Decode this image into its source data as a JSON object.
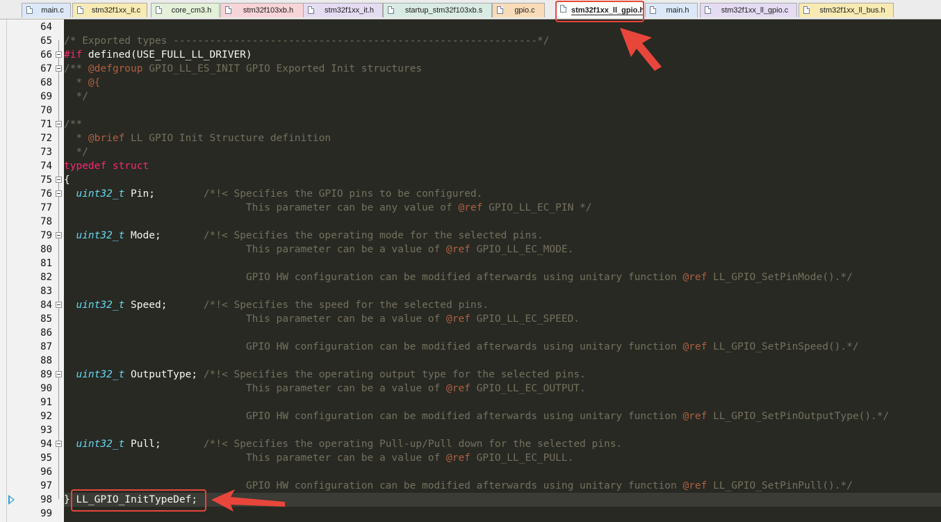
{
  "tabs": [
    {
      "label": "main.c",
      "color": "#dce8f7"
    },
    {
      "label": "stm32f1xx_it.c",
      "color": "#f7eab3"
    },
    {
      "label": "core_cm3.h",
      "color": "#e3f1d8"
    },
    {
      "label": "stm32f103xb.h",
      "color": "#f7d4d7"
    },
    {
      "label": "stm32f1xx_it.h",
      "color": "#e5dcf3"
    },
    {
      "label": "startup_stm32f103xb.s",
      "color": "#d9ece4"
    },
    {
      "label": "gpio.c",
      "color": "#f8dcb8"
    },
    {
      "label": "stm32f1xx_ll_gpio.h",
      "color": "#ffffff",
      "active": true
    },
    {
      "label": "main.h",
      "color": "#dce8f7"
    },
    {
      "label": "stm32f1xx_ll_gpio.c",
      "color": "#e5dcf3"
    },
    {
      "label": "stm32f1xx_ll_bus.h",
      "color": "#f7eab3"
    }
  ],
  "editor": {
    "current_line": "98",
    "lines": [
      {
        "n": "64",
        "segs": []
      },
      {
        "n": "65",
        "segs": [
          [
            "c-com",
            "/* Exported types ------------------------------------------------------------*/"
          ]
        ]
      },
      {
        "n": "66",
        "fold": true,
        "segs": [
          [
            "c-kw",
            "#if"
          ],
          [
            "c-id",
            " defined(USE_FULL_LL_DRIVER)"
          ]
        ]
      },
      {
        "n": "67",
        "fold": true,
        "segs": [
          [
            "c-com",
            "/** "
          ],
          [
            "c-tag",
            "@defgroup"
          ],
          [
            "c-com",
            " GPIO_LL_ES_INIT GPIO Exported Init structures"
          ]
        ]
      },
      {
        "n": "68",
        "segs": [
          [
            "c-com",
            "  * "
          ],
          [
            "c-tag",
            "@{"
          ]
        ]
      },
      {
        "n": "69",
        "segs": [
          [
            "c-com",
            "  */"
          ]
        ]
      },
      {
        "n": "70",
        "segs": []
      },
      {
        "n": "71",
        "fold": true,
        "segs": [
          [
            "c-com",
            "/**"
          ]
        ]
      },
      {
        "n": "72",
        "segs": [
          [
            "c-com",
            "  * "
          ],
          [
            "c-tag",
            "@brief"
          ],
          [
            "c-com",
            " LL GPIO Init Structure definition"
          ]
        ]
      },
      {
        "n": "73",
        "segs": [
          [
            "c-com",
            "  */"
          ]
        ]
      },
      {
        "n": "74",
        "segs": [
          [
            "c-kw",
            "typedef struct"
          ]
        ]
      },
      {
        "n": "75",
        "fold": true,
        "segs": [
          [
            "c-id",
            "{"
          ]
        ]
      },
      {
        "n": "76",
        "fold": true,
        "segs": [
          [
            "c-ty",
            "  uint32_t"
          ],
          [
            "c-id",
            " Pin;        "
          ],
          [
            "c-com",
            "/*!< Specifies the GPIO pins to be configured."
          ]
        ]
      },
      {
        "n": "77",
        "segs": [
          [
            "c-com",
            "                              This parameter can be any value of "
          ],
          [
            "c-tag",
            "@ref"
          ],
          [
            "c-com",
            " GPIO_LL_EC_PIN */"
          ]
        ]
      },
      {
        "n": "78",
        "segs": []
      },
      {
        "n": "79",
        "fold": true,
        "segs": [
          [
            "c-ty",
            "  uint32_t"
          ],
          [
            "c-id",
            " Mode;       "
          ],
          [
            "c-com",
            "/*!< Specifies the operating mode for the selected pins."
          ]
        ]
      },
      {
        "n": "80",
        "segs": [
          [
            "c-com",
            "                              This parameter can be a value of "
          ],
          [
            "c-tag",
            "@ref"
          ],
          [
            "c-com",
            " GPIO_LL_EC_MODE."
          ]
        ]
      },
      {
        "n": "81",
        "segs": []
      },
      {
        "n": "82",
        "segs": [
          [
            "c-com",
            "                              GPIO HW configuration can be modified afterwards using unitary function "
          ],
          [
            "c-tag",
            "@ref"
          ],
          [
            "c-com",
            " LL_GPIO_SetPinMode().*/"
          ]
        ]
      },
      {
        "n": "83",
        "segs": []
      },
      {
        "n": "84",
        "fold": true,
        "segs": [
          [
            "c-ty",
            "  uint32_t"
          ],
          [
            "c-id",
            " Speed;      "
          ],
          [
            "c-com",
            "/*!< Specifies the speed for the selected pins."
          ]
        ]
      },
      {
        "n": "85",
        "segs": [
          [
            "c-com",
            "                              This parameter can be a value of "
          ],
          [
            "c-tag",
            "@ref"
          ],
          [
            "c-com",
            " GPIO_LL_EC_SPEED."
          ]
        ]
      },
      {
        "n": "86",
        "segs": []
      },
      {
        "n": "87",
        "segs": [
          [
            "c-com",
            "                              GPIO HW configuration can be modified afterwards using unitary function "
          ],
          [
            "c-tag",
            "@ref"
          ],
          [
            "c-com",
            " LL_GPIO_SetPinSpeed().*/"
          ]
        ]
      },
      {
        "n": "88",
        "segs": []
      },
      {
        "n": "89",
        "fold": true,
        "segs": [
          [
            "c-ty",
            "  uint32_t"
          ],
          [
            "c-id",
            " OutputType; "
          ],
          [
            "c-com",
            "/*!< Specifies the operating output type for the selected pins."
          ]
        ]
      },
      {
        "n": "90",
        "segs": [
          [
            "c-com",
            "                              This parameter can be a value of "
          ],
          [
            "c-tag",
            "@ref"
          ],
          [
            "c-com",
            " GPIO_LL_EC_OUTPUT."
          ]
        ]
      },
      {
        "n": "91",
        "segs": []
      },
      {
        "n": "92",
        "segs": [
          [
            "c-com",
            "                              GPIO HW configuration can be modified afterwards using unitary function "
          ],
          [
            "c-tag",
            "@ref"
          ],
          [
            "c-com",
            " LL_GPIO_SetPinOutputType().*/"
          ]
        ]
      },
      {
        "n": "93",
        "segs": []
      },
      {
        "n": "94",
        "fold": true,
        "segs": [
          [
            "c-ty",
            "  uint32_t"
          ],
          [
            "c-id",
            " Pull;       "
          ],
          [
            "c-com",
            "/*!< Specifies the operating Pull-up/Pull down for the selected pins."
          ]
        ]
      },
      {
        "n": "95",
        "segs": [
          [
            "c-com",
            "                              This parameter can be a value of "
          ],
          [
            "c-tag",
            "@ref"
          ],
          [
            "c-com",
            " GPIO_LL_EC_PULL."
          ]
        ]
      },
      {
        "n": "96",
        "segs": []
      },
      {
        "n": "97",
        "segs": [
          [
            "c-com",
            "                              GPIO HW configuration can be modified afterwards using unitary function "
          ],
          [
            "c-tag",
            "@ref"
          ],
          [
            "c-com",
            " LL_GPIO_SetPinPull().*/"
          ]
        ]
      },
      {
        "n": "98",
        "segs": [
          [
            "c-id",
            "} LL_GPIO_InitTypeDef;"
          ]
        ]
      },
      {
        "n": "99",
        "segs": []
      }
    ]
  },
  "colors": {
    "editor_bg": "#282923",
    "comment": "#75715e",
    "keyword": "#f92672",
    "type": "#66d9ef",
    "highlight": "#e9463b"
  }
}
